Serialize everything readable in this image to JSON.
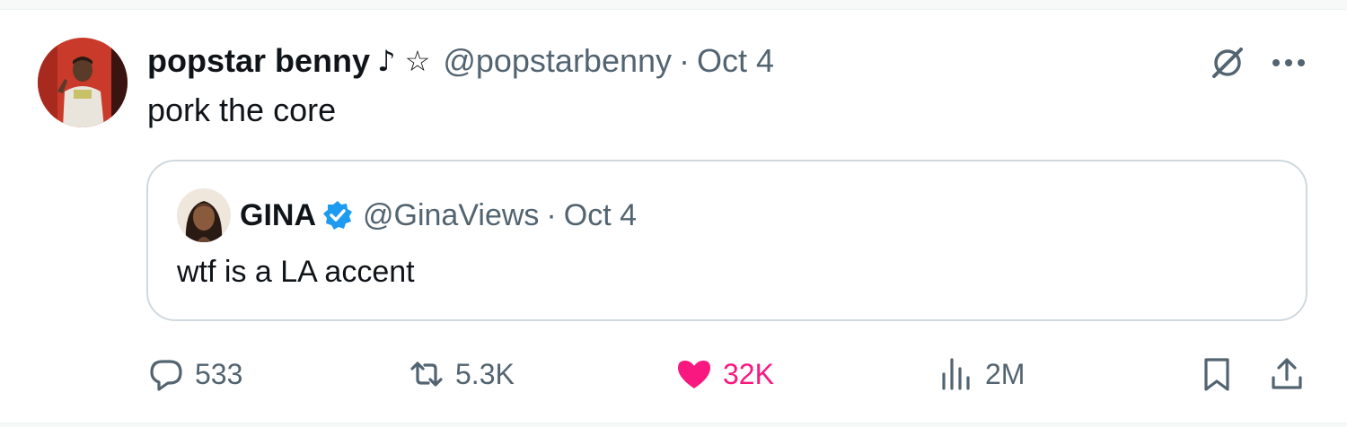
{
  "tweet": {
    "author_name": "popstar benny",
    "name_glyphs": "♪ ☆",
    "handle": "@popstarbenny",
    "separator": "·",
    "time": "Oct 4",
    "text": "pork the core"
  },
  "quote": {
    "author_name": "GINA",
    "verified": true,
    "handle": "@GinaViews",
    "separator": "·",
    "time": "Oct 4",
    "text": "wtf is a LA accent"
  },
  "actions": {
    "replies": "533",
    "reposts": "5.3K",
    "likes": "32K",
    "views": "2M"
  },
  "colors": {
    "text": "#0f1419",
    "muted": "#536471",
    "like": "#f91880",
    "verified": "#1d9bf0",
    "border": "#cfd9de"
  },
  "icons": {
    "reply": "speech-bubble-icon",
    "repost": "repost-arrows-icon",
    "like": "heart-filled-icon",
    "views": "bar-chart-icon",
    "bookmark": "bookmark-icon",
    "share": "share-icon",
    "grok": "grok-icon",
    "more": "more-dots-icon"
  }
}
